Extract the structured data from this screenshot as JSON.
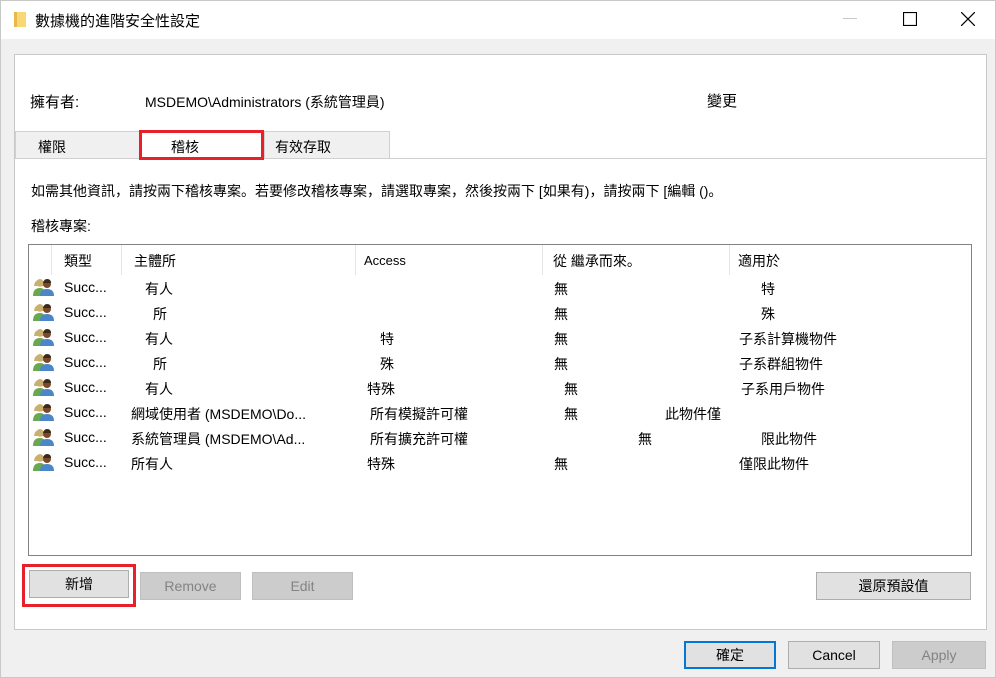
{
  "window": {
    "title": "數據機的進階安全性設定",
    "controls": {
      "minimize": "minimize",
      "maximize": "maximize",
      "close": "close"
    }
  },
  "owner": {
    "label": "擁有者:",
    "value": "MSDEMO\\Administrators (系統管理員)",
    "change_label": "變更"
  },
  "tabs": [
    {
      "label": "權限",
      "active": false
    },
    {
      "label": "稽核",
      "active": true
    },
    {
      "label": "有效存取",
      "active": false
    }
  ],
  "description": "如需其他資訊，請按兩下稽核專案。若要修改稽核專案，請選取專案，然後按兩下 [如果有)，請按兩下 [編輯 ()。",
  "list_label": "稽核專案:",
  "table": {
    "columns": [
      "類型",
      "主體所",
      "Access",
      "從 繼承而來。",
      "適用於"
    ],
    "rows": [
      {
        "icon": "users-icon",
        "type": "Succ...",
        "principal": "有人",
        "access": "",
        "inherited": "無",
        "applies": "特"
      },
      {
        "icon": "users-icon",
        "type": "Succ...",
        "principal": "所",
        "access": "",
        "inherited": "無",
        "applies": "殊"
      },
      {
        "icon": "users-icon",
        "type": "Succ...",
        "principal": "有人",
        "access": "特",
        "inherited": "無",
        "applies": "子系計算機物件"
      },
      {
        "icon": "users-icon",
        "type": "Succ...",
        "principal": "所",
        "access": "殊",
        "inherited": "無",
        "applies": "子系群組物件"
      },
      {
        "icon": "users-icon",
        "type": "Succ...",
        "principal": "有人",
        "access": "特殊",
        "inherited": "無",
        "applies": "子系用戶物件"
      },
      {
        "icon": "users-icon",
        "type": "Succ...",
        "principal": "網域使用者 (MSDEMO\\Do...",
        "access": "所有模擬許可權",
        "inherited": "無",
        "applies": "此物件僅"
      },
      {
        "icon": "users-icon",
        "type": "Succ...",
        "principal": "系統管理員 (MSDEMO\\Ad...",
        "access": "所有擴充許可權",
        "inherited": "無",
        "applies": "限此物件"
      },
      {
        "icon": "users-icon",
        "type": "Succ...",
        "principal": "所有人",
        "access": "特殊",
        "inherited": "無",
        "applies": "僅限此物件"
      }
    ]
  },
  "buttons": {
    "add": "新增",
    "remove": "Remove",
    "edit": "Edit",
    "restore_defaults": "還原預設值",
    "ok": "確定",
    "cancel": "Cancel",
    "apply": "Apply"
  },
  "colors": {
    "highlight": "#e8202a",
    "focus": "#0078d7"
  }
}
